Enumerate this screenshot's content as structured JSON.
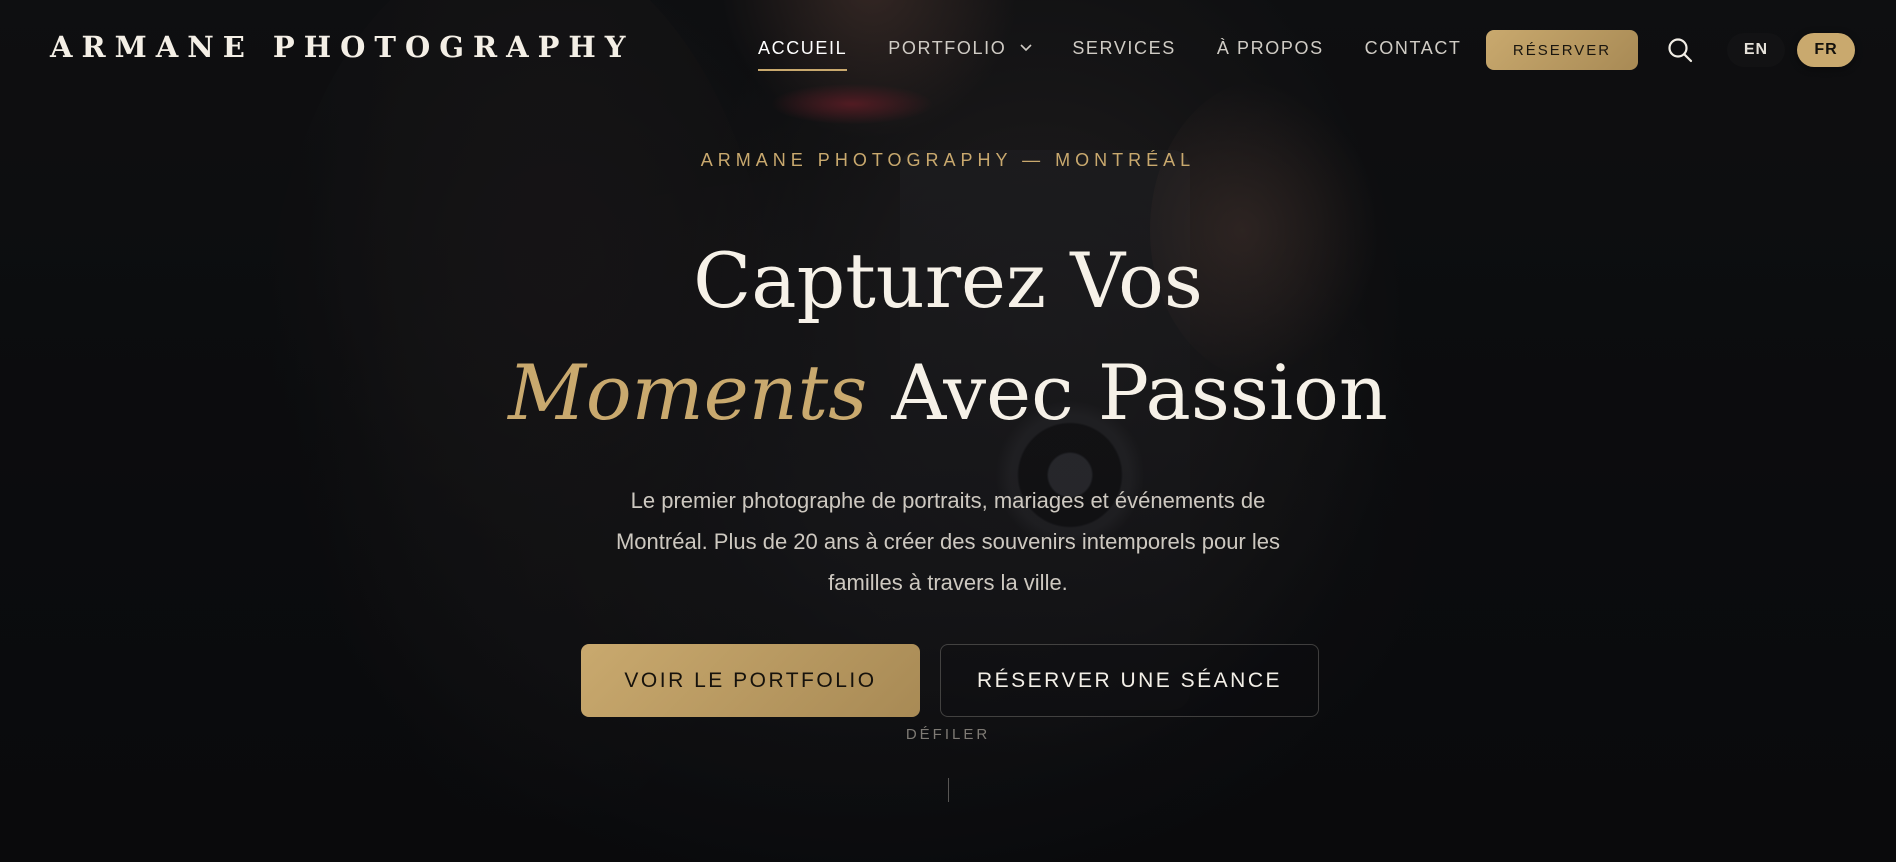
{
  "brand": {
    "logo_text": "ARMANE PHOTOGRAPHY"
  },
  "nav": {
    "items": [
      {
        "label": "ACCUEIL",
        "active": true
      },
      {
        "label": "PORTFOLIO",
        "has_dropdown": true
      },
      {
        "label": "SERVICES"
      },
      {
        "label": "À PROPOS"
      },
      {
        "label": "CONTACT"
      }
    ],
    "reserve_label": "RÉSERVER",
    "search_icon": "search-icon",
    "languages": [
      {
        "code": "EN",
        "selected": false
      },
      {
        "code": "FR",
        "selected": true
      }
    ]
  },
  "hero": {
    "eyebrow": "ARMANE PHOTOGRAPHY — MONTRÉAL",
    "title_line1": "Capturez Vos",
    "title_accent": "Moments",
    "title_line2_rest": "Avec Passion",
    "subtitle": "Le premier photographe de portraits, mariages et événements de Montréal. Plus de 20 ans à créer des souvenirs intemporels pour les familles à travers la ville.",
    "primary_cta": "VOIR LE PORTFOLIO",
    "secondary_cta": "RÉSERVER UNE SÉANCE",
    "scroll_label": "DÉFILER"
  },
  "colors": {
    "accent_gold": "#c9a96e",
    "background": "#0c0d10",
    "text_light": "#f6f1e8"
  }
}
